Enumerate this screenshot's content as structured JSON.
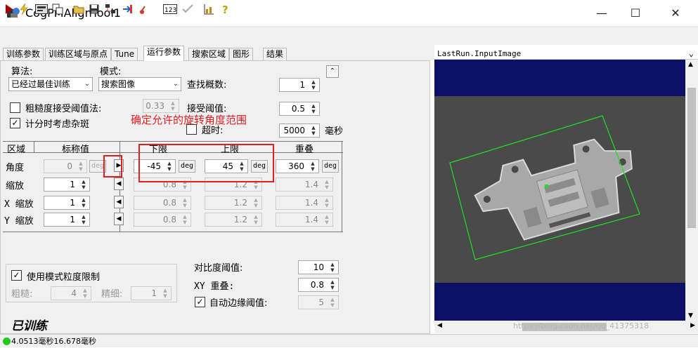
{
  "window": {
    "title": "CogPMAlignTool1",
    "minimize": "—",
    "maximize": "☐",
    "close": "✕"
  },
  "toolbar": {
    "icons": [
      "run-icon",
      "lightning-icon",
      "display-icon",
      "copy-icon",
      "open-icon",
      "save-icon",
      "network-icon",
      "import-icon",
      "reset-icon",
      "number-icon",
      "check-icon",
      "chart-icon",
      "help-icon"
    ]
  },
  "tabs": [
    "训练参数",
    "训练区域与原点",
    "Tune",
    "运行参数",
    "搜索区域",
    "图形",
    "结果"
  ],
  "params": {
    "algorithm_label": "算法:",
    "algorithm_value": "已经过最佳训练",
    "mode_label": "模式:",
    "mode_value": "搜索图像",
    "find_count_label": "查找概数:",
    "find_count_value": "1",
    "coarse_threshold_label": "粗糙度接受阈值法:",
    "coarse_threshold_value": "0.33",
    "accept_threshold_label": "接受阈值:",
    "accept_threshold_value": "0.5",
    "clutter_label": "计分时考虑杂斑",
    "timeout_label": "超时:",
    "timeout_value": "5000",
    "timeout_unit": "毫秒",
    "annotation": "确定允许的旋转角度范围"
  },
  "table": {
    "headers": {
      "region": "区域",
      "nominal": "标称值",
      "low": "下限",
      "high": "上限",
      "overlap": "重叠"
    },
    "deg": "deg",
    "rows": [
      {
        "label": "角度",
        "nominal": "0",
        "low": "-45",
        "high": "45",
        "overlap": "360"
      },
      {
        "label": "缩放",
        "nominal": "1",
        "low": "0.8",
        "high": "1.2",
        "overlap": "1.4"
      },
      {
        "label": "X 缩放",
        "nominal": "1",
        "low": "0.8",
        "high": "1.2",
        "overlap": "1.4"
      },
      {
        "label": "Y 缩放",
        "nominal": "1",
        "low": "0.8",
        "high": "1.2",
        "overlap": "1.4"
      }
    ]
  },
  "granularity": {
    "label": "使用模式粒度限制",
    "coarse_label": "粗糙:",
    "coarse_value": "4",
    "fine_label": "精细:",
    "fine_value": "1"
  },
  "contrast": {
    "label": "对比度阈值:",
    "value": "10"
  },
  "xy_overlap": {
    "label": "XY 重叠:",
    "value": "0.8"
  },
  "auto_edge": {
    "label": "自动边缘阈值:",
    "value": "5"
  },
  "trained_label": "已训练",
  "view": {
    "title": "LastRun.InputImage"
  },
  "status": {
    "text": "4.0513毫秒16.678毫秒",
    "status_color": "#1ecb1e"
  },
  "colors": {
    "annotation": "#e02020",
    "highlight_box": "#e02020",
    "result_box": "#20e020",
    "image_bg": "#0b1066"
  },
  "watermark": "https://blog.csdn.net/qq_41375318"
}
